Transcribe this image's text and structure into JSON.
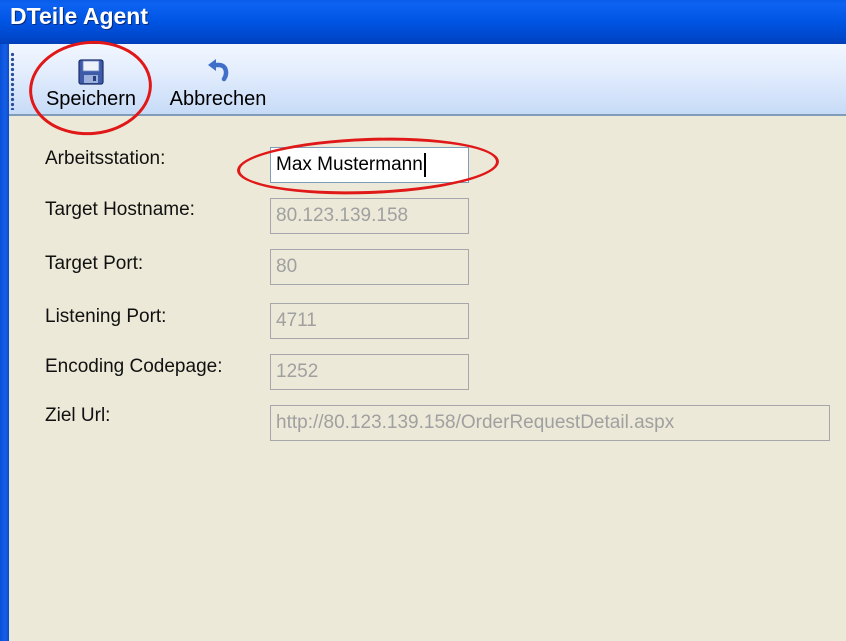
{
  "window": {
    "title": "DTeile Agent"
  },
  "toolbar": {
    "save_label": "Speichern",
    "save_icon": "floppy-disk-icon",
    "cancel_label": "Abbrechen",
    "cancel_icon": "undo-arrow-icon"
  },
  "form": {
    "fields": [
      {
        "label": "Arbeitsstation:",
        "value": "Max Mustermann",
        "enabled": true
      },
      {
        "label": "Target Hostname:",
        "value": "80.123.139.158",
        "enabled": false
      },
      {
        "label": "Target Port:",
        "value": "80",
        "enabled": false
      },
      {
        "label": "Listening Port:",
        "value": "4711",
        "enabled": false
      },
      {
        "label": "Encoding Codepage:",
        "value": "1252",
        "enabled": false
      },
      {
        "label": "Ziel Url:",
        "value": "http://80.123.139.158/OrderRequestDetail.aspx",
        "enabled": false
      }
    ]
  },
  "colors": {
    "titlebar": "#0054e3",
    "toolbar": "#dfe9fb",
    "client_area": "#ece9d8",
    "annotation": "#e01818",
    "disabled_text": "#a0a0a0"
  }
}
